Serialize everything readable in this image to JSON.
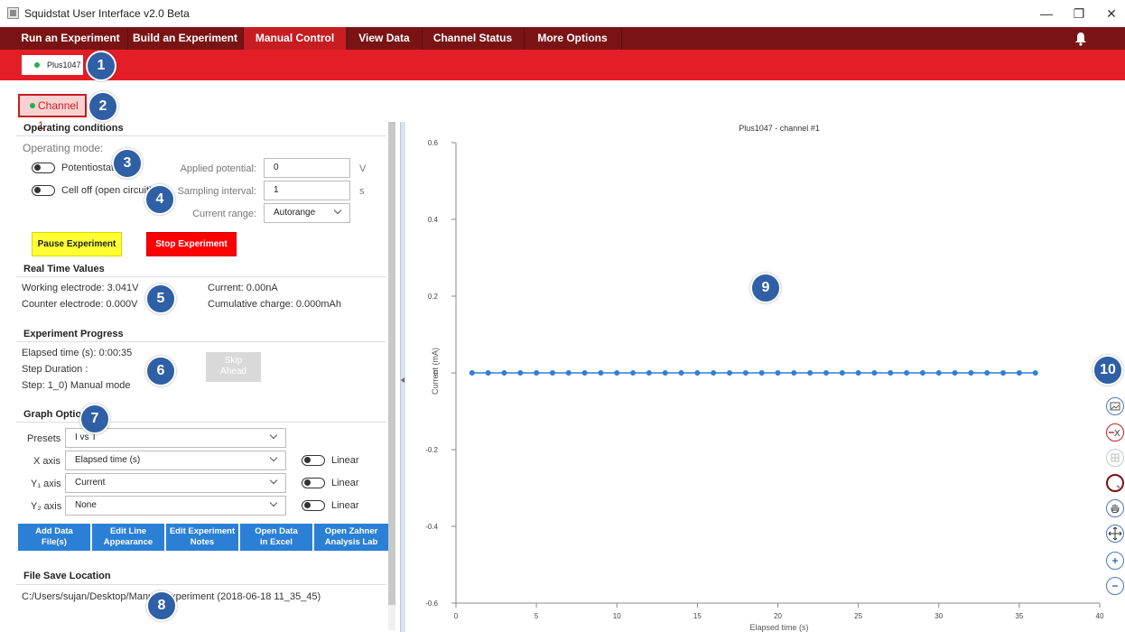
{
  "window": {
    "title": "Squidstat User Interface v2.0 Beta",
    "controls": {
      "minimize": "—",
      "maximize": "❐",
      "close": "✕"
    }
  },
  "menu": {
    "items": [
      "Run an Experiment",
      "Build an Experiment",
      "Manual Control",
      "View Data",
      "Channel Status",
      "More Options"
    ],
    "active": "Manual Control"
  },
  "device_tab": {
    "label": "Plus1047"
  },
  "channel": {
    "label": "Channel 1"
  },
  "callouts": [
    "1",
    "2",
    "3",
    "4",
    "5",
    "6",
    "7",
    "8",
    "9",
    "10"
  ],
  "operating": {
    "title": "Operating conditions",
    "mode_label": "Operating mode:",
    "potentiostat": "Potentiostatic",
    "cell_off": "Cell off (open circuit)",
    "applied_potential_label": "Applied potential:",
    "applied_potential_value": "0",
    "applied_potential_unit": "V",
    "sampling_label": "Sampling interval:",
    "sampling_value": "1",
    "sampling_unit": "s",
    "current_range_label": "Current range:",
    "current_range_value": "Autorange",
    "pause_label": "Pause Experiment",
    "stop_label": "Stop Experiment"
  },
  "realtime": {
    "title": "Real Time Values",
    "working": "Working electrode: 3.041V",
    "counter": "Counter electrode: 0.000V",
    "current": "Current: 0.00nA",
    "charge": "Cumulative charge: 0.000mAh"
  },
  "progress": {
    "title": "Experiment Progress",
    "elapsed": "Elapsed time (s): 0:00:35",
    "duration": "Step Duration :",
    "step": "Step: 1_0) Manual mode",
    "skip_line1": "Skip",
    "skip_line2": "Ahead"
  },
  "graph_options": {
    "title": "Graph Options",
    "presets_label": "Presets",
    "presets_value": "I vs T",
    "x_label": "X axis",
    "x_value": "Elapsed time (s)",
    "y1_label": "Y₁ axis",
    "y1_value": "Current",
    "y2_label": "Y₂ axis",
    "y2_value": "None",
    "linear_label": "Linear"
  },
  "action_buttons": [
    {
      "l1": "Add Data",
      "l2": "File(s)"
    },
    {
      "l1": "Edit Line",
      "l2": "Appearance"
    },
    {
      "l1": "Edit Experiment",
      "l2": "Notes"
    },
    {
      "l1": "Open Data",
      "l2": "in Excel"
    },
    {
      "l1": "Open Zahner",
      "l2": "Analysis Lab"
    }
  ],
  "file_save": {
    "title": "File Save Location",
    "path": "C:/Users/sujan/Desktop/Manual Experiment (2018-06-18 11_35_45)"
  },
  "chart_data": {
    "type": "line",
    "title": "Plus1047 - channel #1",
    "xlabel": "Elapsed time (s)",
    "ylabel": "Current (mA)",
    "xlim": [
      0,
      40
    ],
    "ylim": [
      -0.6,
      0.6
    ],
    "xticks": [
      0,
      5,
      10,
      15,
      20,
      25,
      30,
      35,
      40
    ],
    "yticks": [
      0.6,
      0.4,
      0.2,
      0,
      -0.2,
      -0.4,
      -0.6
    ],
    "ytick_labels": [
      "0.6",
      "0.4",
      "0.2",
      "0",
      "-0.2",
      "-0.4",
      "-0.6"
    ],
    "series": [
      {
        "color": "#2f7fd6",
        "x": [
          1,
          2,
          3,
          4,
          5,
          6,
          7,
          8,
          9,
          10,
          11,
          12,
          13,
          14,
          15,
          16,
          17,
          18,
          19,
          20,
          21,
          22,
          23,
          24,
          25,
          26,
          27,
          28,
          29,
          30,
          31,
          32,
          33,
          34,
          35,
          36
        ],
        "y": [
          0,
          0,
          0,
          0,
          0,
          0,
          0,
          0,
          0,
          0,
          0,
          0,
          0,
          0,
          0,
          0,
          0,
          0,
          0,
          0,
          0,
          0,
          0,
          0,
          0,
          0,
          0,
          0,
          0,
          0,
          0,
          0,
          0,
          0,
          0,
          0
        ]
      }
    ],
    "grid": false
  },
  "chart_tools": [
    "image-export-icon",
    "remove-x-icon",
    "grid-icon",
    "zoom-region-icon",
    "pan-hand-icon",
    "move-icon",
    "zoom-in-icon",
    "zoom-out-icon"
  ],
  "colors": {
    "menu_bg": "#7a1414",
    "accent_red": "#e41e26",
    "plot_blue": "#2f7fd6"
  }
}
